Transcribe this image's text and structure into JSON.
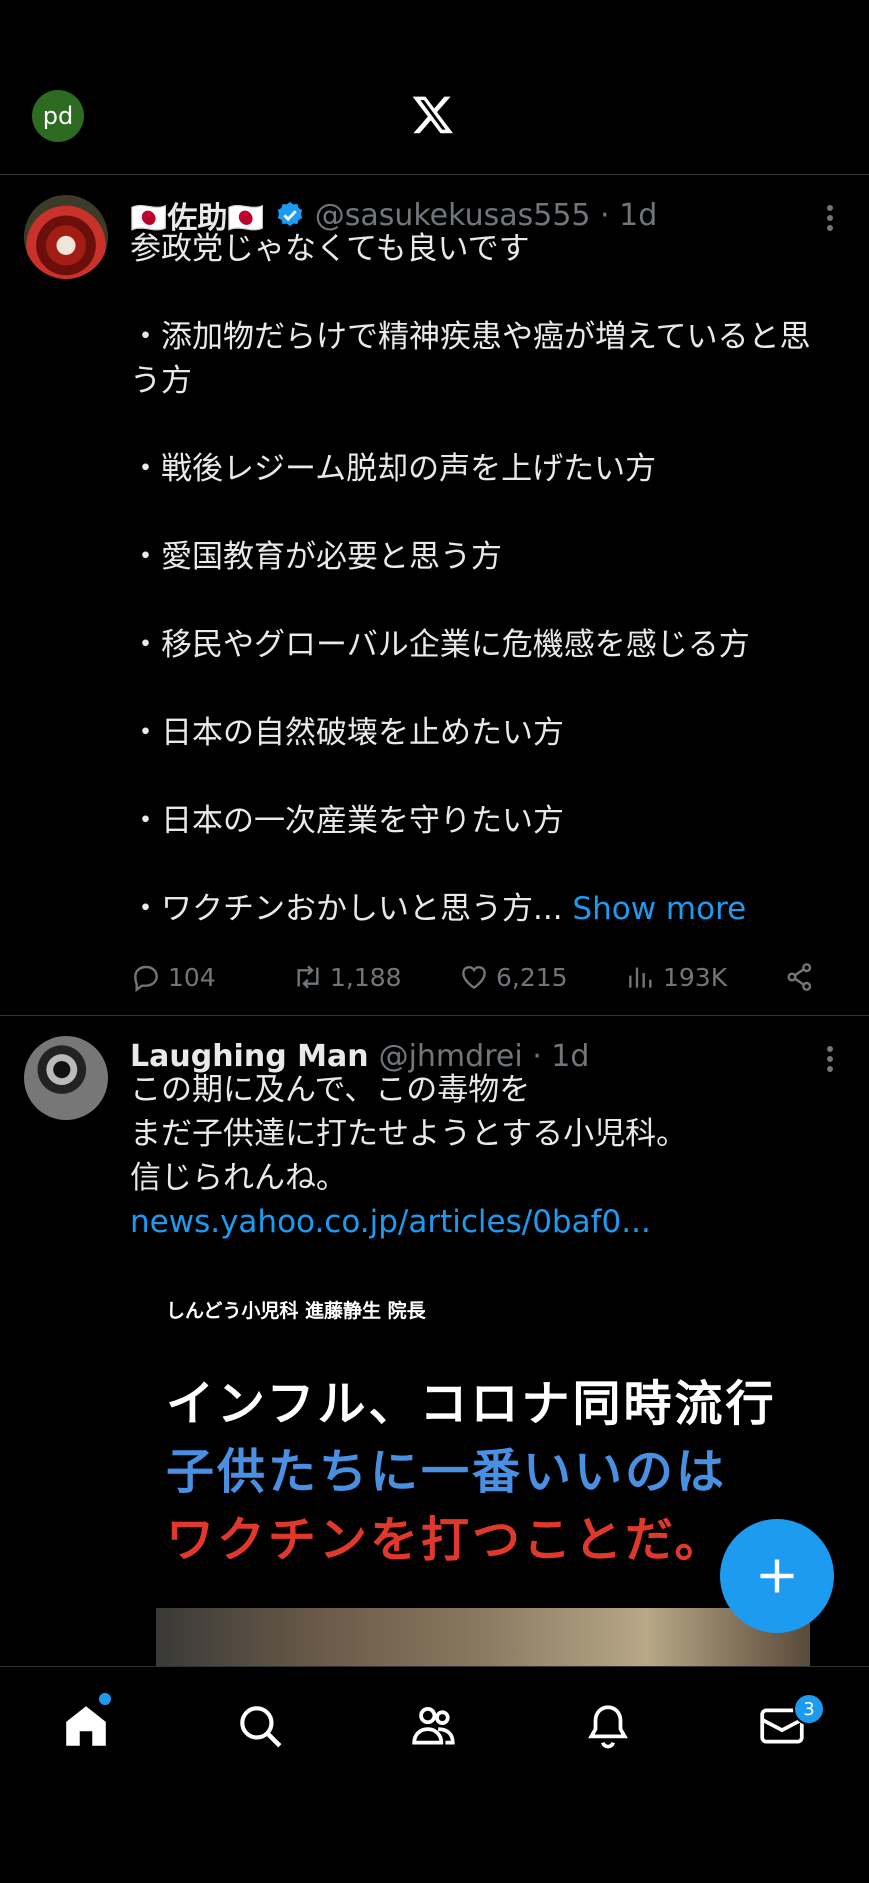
{
  "header": {
    "avatar_initials": "pd",
    "logo": "x-logo-icon"
  },
  "tweets": [
    {
      "display_name": "🇯🇵佐助🇯🇵",
      "handle": "@sasukekusas555 · 1d",
      "verified": true,
      "text": "参政党じゃなくても良いです\n\n・添加物だらけで精神疾患や癌が増えていると思う方\n\n・戦後レジーム脱却の声を上げたい方\n\n・愛国教育が必要と思う方\n\n・移民やグローバル企業に危機感を感じる方\n\n・日本の自然破壊を止めたい方\n\n・日本の一次産業を守りたい方\n\n・ワクチンおかしいと思う方...",
      "show_more": "Show more",
      "replies": "104",
      "reposts": "1,188",
      "likes": "6,215",
      "views": "193K"
    },
    {
      "display_name": "Laughing Man",
      "handle": "@jhmdrei · 1d",
      "text": "この期に及んで、この毒物を\nまだ子供達に打たせようとする小児科。\n信じられんね。",
      "link": "news.yahoo.co.jp/articles/0baf0...",
      "card": {
        "caption": "しんどう小児科 進藤静生 院長",
        "line1": "インフル、コロナ同時流行",
        "line2": "子供たちに一番いいのは",
        "line3": "ワクチンを打つことだ。"
      }
    }
  ],
  "nav": {
    "items": [
      "home-icon",
      "search-icon",
      "communities-icon",
      "notifications-icon",
      "messages-icon"
    ],
    "messages_badge": "3"
  },
  "colors": {
    "accent": "#1d9bf0",
    "background": "#000000",
    "muted": "#71767b"
  }
}
